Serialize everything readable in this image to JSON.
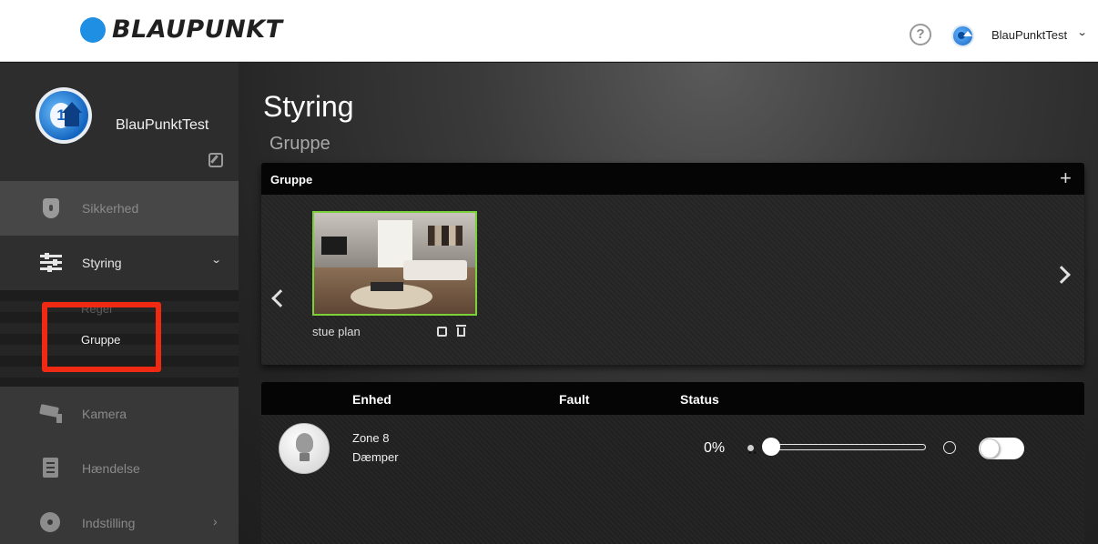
{
  "header": {
    "brand": "BLAUPUNKT",
    "help_label": "?",
    "username": "BlauPunktTest",
    "caret": "⌄"
  },
  "sidebar": {
    "profile_name": "BlauPunktTest",
    "avatar_number": "1",
    "items": [
      {
        "label": "Sikkerhed",
        "icon": "shield-icon"
      },
      {
        "label": "Styring",
        "icon": "sliders-icon",
        "chevron": "⌄"
      },
      {
        "label": "Kamera",
        "icon": "camera-icon"
      },
      {
        "label": "Hændelse",
        "icon": "document-icon"
      },
      {
        "label": "Indstilling",
        "icon": "gear-icon",
        "chevron": "›"
      }
    ],
    "subitems": [
      {
        "label": "Gruppe"
      },
      {
        "label": "Regel"
      }
    ]
  },
  "main": {
    "title": "Styring",
    "subtitle": "Gruppe",
    "group_panel": {
      "title": "Gruppe",
      "add_label": "+",
      "groups": [
        {
          "label": "stue plan"
        }
      ]
    },
    "device_panel": {
      "columns": [
        "Enhed",
        "Fault",
        "Status"
      ],
      "rows": [
        {
          "name": "Zone 8",
          "type": "Dæmper",
          "level_text": "0%",
          "level": 0,
          "on": false
        }
      ]
    }
  },
  "colors": {
    "accent_blue": "#1f8fe4",
    "selected_border": "#7ad13a",
    "highlight_red": "#f02a12"
  }
}
